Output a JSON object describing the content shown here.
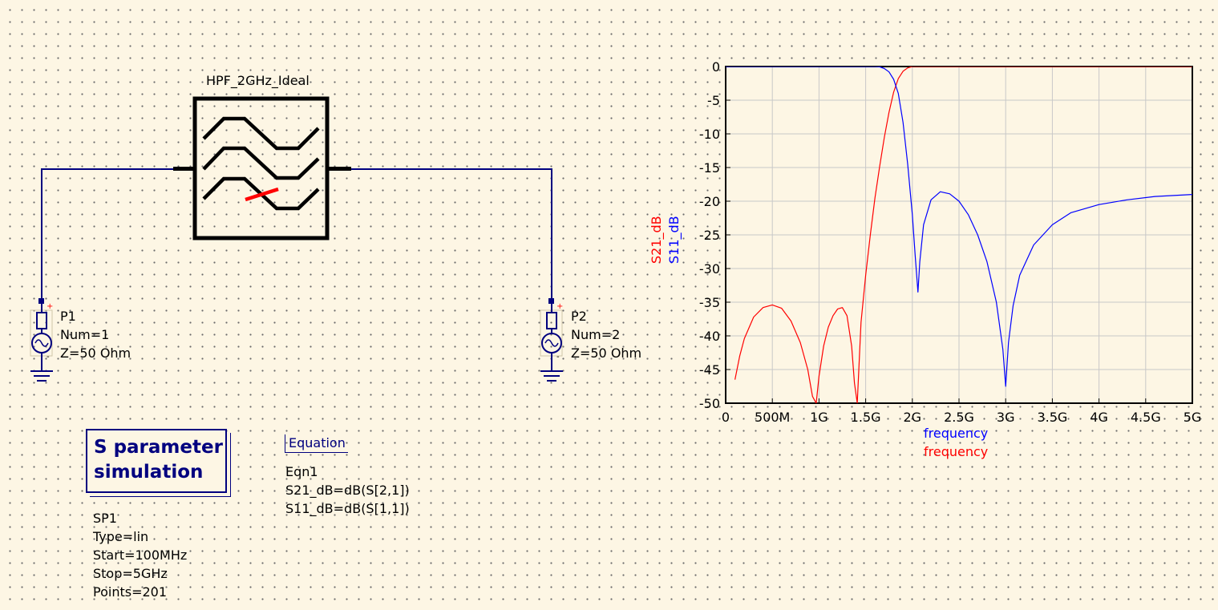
{
  "schematic": {
    "filter": {
      "name": "HPF_2GHz_Ideal"
    },
    "ports": [
      {
        "name": "P1",
        "num": "Num=1",
        "z": "Z=50 Ohm"
      },
      {
        "name": "P2",
        "num": "Num=2",
        "z": "Z=50 Ohm"
      }
    ],
    "sim": {
      "title_line1": "S parameter",
      "title_line2": "simulation",
      "name": "SP1",
      "type": "Type=lin",
      "start": "Start=100MHz",
      "stop": "Stop=5GHz",
      "points": "Points=201"
    },
    "equation": {
      "header": "Equation",
      "name": "Eqn1",
      "eq1": "S21_dB=dB(S[2,1])",
      "eq2": "S11_dB=dB(S[1,1])"
    },
    "colors": {
      "wire": "#00007f",
      "component": "#000000",
      "marker": "#ff0000"
    }
  },
  "chart_data": {
    "type": "line",
    "xlabel": [
      "frequency",
      "frequency"
    ],
    "ylabel": [
      "S21_dB",
      "S11_dB"
    ],
    "xlim": [
      0,
      5
    ],
    "ylim": [
      -50,
      0
    ],
    "x_unit": "GHz",
    "grid": true,
    "xticks": [
      "0",
      "500M",
      "1G",
      "1.5G",
      "2G",
      "2.5G",
      "3G",
      "3.5G",
      "4G",
      "4.5G",
      "5G"
    ],
    "yticks": [
      "0",
      "-5",
      "-10",
      "-15",
      "-20",
      "-25",
      "-30",
      "-35",
      "-40",
      "-45",
      "-50"
    ],
    "series": [
      {
        "name": "S21_dB",
        "color": "#ff0000",
        "x": [
          0.1,
          0.15,
          0.2,
          0.3,
          0.4,
          0.5,
          0.6,
          0.7,
          0.8,
          0.88,
          0.93,
          0.97,
          1.0,
          1.05,
          1.1,
          1.15,
          1.2,
          1.25,
          1.3,
          1.35,
          1.38,
          1.41,
          1.45,
          1.5,
          1.55,
          1.6,
          1.65,
          1.7,
          1.75,
          1.8,
          1.85,
          1.9,
          1.95,
          2.0,
          2.1,
          2.5,
          3.0,
          4.0,
          5.0
        ],
        "y": [
          -46.5,
          -43.0,
          -40.4,
          -37.2,
          -35.8,
          -35.4,
          -35.9,
          -37.8,
          -41.0,
          -45.0,
          -49.0,
          -50.0,
          -46.0,
          -41.5,
          -38.7,
          -37.0,
          -36.0,
          -35.8,
          -37.0,
          -41.5,
          -47.0,
          -50.0,
          -38.0,
          -31.0,
          -25.0,
          -19.5,
          -14.8,
          -10.5,
          -6.8,
          -3.8,
          -1.8,
          -0.7,
          -0.2,
          0.0,
          0.0,
          0.0,
          0.0,
          0.0,
          0.0
        ]
      },
      {
        "name": "S11_dB",
        "color": "#0000ff",
        "x": [
          0.0,
          1.6,
          1.65,
          1.7,
          1.75,
          1.8,
          1.85,
          1.9,
          1.95,
          2.0,
          2.03,
          2.06,
          2.08,
          2.12,
          2.2,
          2.3,
          2.4,
          2.5,
          2.6,
          2.7,
          2.8,
          2.9,
          2.97,
          3.0,
          3.03,
          3.08,
          3.15,
          3.3,
          3.5,
          3.7,
          4.0,
          4.3,
          4.6,
          5.0
        ],
        "y": [
          0.0,
          0.0,
          -0.05,
          -0.3,
          -0.8,
          -1.9,
          -4.0,
          -8.3,
          -14.5,
          -22.0,
          -28.0,
          -33.5,
          -29.0,
          -23.5,
          -19.8,
          -18.6,
          -18.9,
          -20.0,
          -22.0,
          -25.0,
          -29.0,
          -35.0,
          -42.0,
          -47.5,
          -41.0,
          -35.5,
          -31.0,
          -26.5,
          -23.5,
          -21.7,
          -20.5,
          -19.8,
          -19.3,
          -19.0
        ]
      }
    ]
  }
}
